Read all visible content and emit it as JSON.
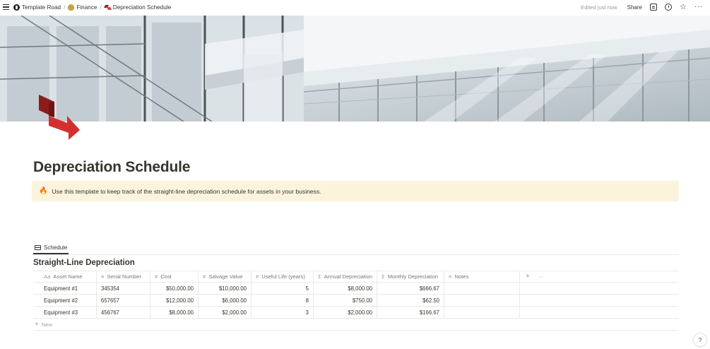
{
  "topbar": {
    "breadcrumbs": [
      {
        "label": "Template Road",
        "icon": "template-road-logo-icon"
      },
      {
        "label": "Finance",
        "icon": "money-bag-icon"
      },
      {
        "label": "Depreciation Schedule",
        "icon": "depreciation-arrow-icon"
      }
    ],
    "separator": "/",
    "edited": "Edited just now",
    "share": "Share"
  },
  "page": {
    "title": "Depreciation Schedule",
    "callout_icon": "🔥",
    "callout_text": "Use this template to keep track of the straight-line depreciation schedule for assets in your business."
  },
  "database": {
    "view_tab": "Schedule",
    "title": "Straight-Line Depreciation",
    "columns": [
      {
        "icon": "Aa",
        "label": "Asset Name"
      },
      {
        "icon": "≡",
        "label": "Serial Number"
      },
      {
        "icon": "#",
        "label": "Cost"
      },
      {
        "icon": "#",
        "label": "Salvage Value"
      },
      {
        "icon": "#",
        "label": "Useful Life (years)"
      },
      {
        "icon": "Σ",
        "label": "Annual Depreciation"
      },
      {
        "icon": "Σ",
        "label": "Monthly Depreciation"
      },
      {
        "icon": "≡",
        "label": "Notes"
      }
    ],
    "add_column": "+",
    "more": "···",
    "rows": [
      {
        "name": "Equipment #1",
        "serial": "345354",
        "cost": "$50,000.00",
        "salvage": "$10,000.00",
        "life": "5",
        "annual": "$8,000.00",
        "monthly": "$666.67",
        "notes": ""
      },
      {
        "name": "Equipment #2",
        "serial": "657657",
        "cost": "$12,000.00",
        "salvage": "$6,000.00",
        "life": "8",
        "annual": "$750.00",
        "monthly": "$62.50",
        "notes": ""
      },
      {
        "name": "Equipment #3",
        "serial": "456767",
        "cost": "$8,000.00",
        "salvage": "$2,000.00",
        "life": "3",
        "annual": "$2,000.00",
        "monthly": "$166.67",
        "notes": ""
      }
    ],
    "new_label": "New"
  },
  "help": "?",
  "colors": {
    "callout_bg": "#fbf3db",
    "text": "#37352f",
    "muted": "#787774",
    "border": "#e9e9e7",
    "logo_red": "#c62828"
  }
}
